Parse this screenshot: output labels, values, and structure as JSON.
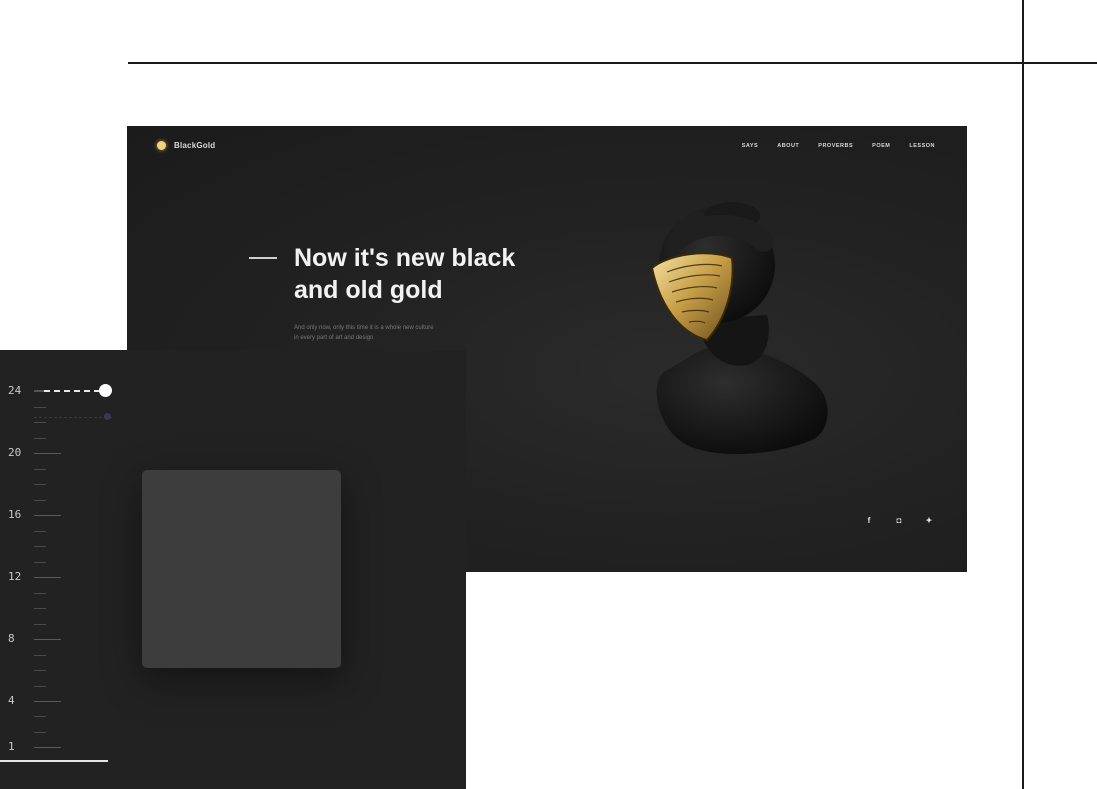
{
  "hero": {
    "brand_name": "BlackGold",
    "nav": [
      "SAYS",
      "ABOUT",
      "PROVERBS",
      "POEM",
      "LESSON"
    ],
    "headline_line1": "Now it's new black",
    "headline_line2": "and old gold",
    "subtext_line1": "And only now, only this time it is a whole new culture",
    "subtext_line2": "in every part of art and design",
    "socials": [
      {
        "icon": "facebook-icon",
        "glyph": "f"
      },
      {
        "icon": "instagram-icon",
        "glyph": "◘"
      },
      {
        "icon": "twitter-icon",
        "glyph": "✦"
      }
    ],
    "accent_color": "#f3d27a",
    "background_color": "#1e1e1e"
  },
  "ruler": {
    "labels": [
      "24",
      "20",
      "16",
      "12",
      "8",
      "4",
      "1"
    ],
    "current_value": 24
  }
}
